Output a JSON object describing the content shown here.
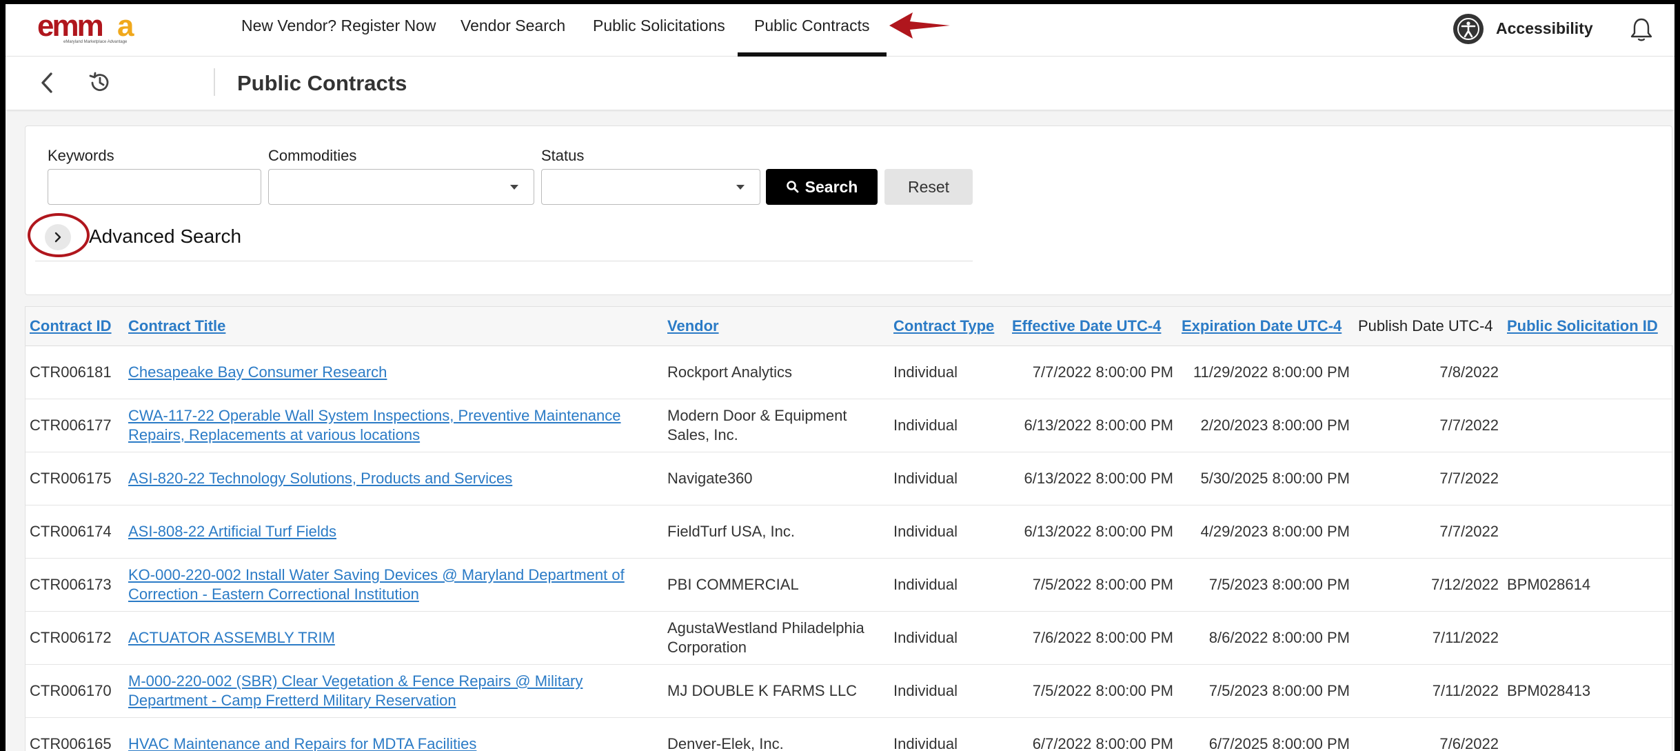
{
  "nav": {
    "logo_text": "emma",
    "logo_tagline": "eMaryland Marketplace Advantage",
    "items": [
      {
        "label": "New Vendor? Register Now"
      },
      {
        "label": "Vendor Search"
      },
      {
        "label": "Public Solicitations"
      },
      {
        "label": "Public Contracts"
      }
    ],
    "accessibility_label": "Accessibility"
  },
  "subheader": {
    "title": "Public Contracts"
  },
  "search": {
    "keywords_label": "Keywords",
    "keywords_value": "",
    "commodities_label": "Commodities",
    "commodities_value": "",
    "status_label": "Status",
    "status_value": "",
    "search_button": "Search",
    "reset_button": "Reset",
    "advanced_label": "Advanced Search"
  },
  "table": {
    "columns": [
      "Contract ID",
      "Contract Title",
      "Vendor",
      "Contract Type",
      "Effective Date UTC-4",
      "Expiration Date UTC-4",
      "Publish Date UTC-4",
      "Public Solicitation ID"
    ],
    "rows": [
      {
        "id": "CTR006181",
        "title": "Chesapeake Bay Consumer Research",
        "vendor": "Rockport Analytics",
        "type": "Individual",
        "effective": "7/7/2022 8:00:00 PM",
        "expiration": "11/29/2022 8:00:00 PM",
        "publish": "7/8/2022",
        "solicitation": ""
      },
      {
        "id": "CTR006177",
        "title": "CWA-117-22 Operable Wall System Inspections, Preventive Maintenance Repairs, Replacements at various locations",
        "vendor": "Modern Door & Equipment Sales, Inc.",
        "type": "Individual",
        "effective": "6/13/2022 8:00:00 PM",
        "expiration": "2/20/2023 8:00:00 PM",
        "publish": "7/7/2022",
        "solicitation": ""
      },
      {
        "id": "CTR006175",
        "title": "ASI-820-22 Technology Solutions, Products and Services",
        "vendor": "Navigate360",
        "type": "Individual",
        "effective": "6/13/2022 8:00:00 PM",
        "expiration": "5/30/2025 8:00:00 PM",
        "publish": "7/7/2022",
        "solicitation": ""
      },
      {
        "id": "CTR006174",
        "title": "ASI-808-22 Artificial Turf Fields",
        "vendor": "FieldTurf USA, Inc.",
        "type": "Individual",
        "effective": "6/13/2022 8:00:00 PM",
        "expiration": "4/29/2023 8:00:00 PM",
        "publish": "7/7/2022",
        "solicitation": ""
      },
      {
        "id": "CTR006173",
        "title": "KO-000-220-002 Install Water Saving Devices @ Maryland Department of Correction - Eastern Correctional Institution",
        "vendor": "PBI COMMERCIAL",
        "type": "Individual",
        "effective": "7/5/2022 8:00:00 PM",
        "expiration": "7/5/2023 8:00:00 PM",
        "publish": "7/12/2022",
        "solicitation": "BPM028614"
      },
      {
        "id": "CTR006172",
        "title": "ACTUATOR ASSEMBLY TRIM",
        "vendor": "AgustaWestland Philadelphia Corporation",
        "type": "Individual",
        "effective": "7/6/2022 8:00:00 PM",
        "expiration": "8/6/2022 8:00:00 PM",
        "publish": "7/11/2022",
        "solicitation": ""
      },
      {
        "id": "CTR006170",
        "title": "M-000-220-002 (SBR) Clear Vegetation & Fence Repairs @ Military Department - Camp Fretterd Military Reservation",
        "vendor": "MJ DOUBLE K FARMS LLC",
        "type": "Individual",
        "effective": "7/5/2022 8:00:00 PM",
        "expiration": "7/5/2023 8:00:00 PM",
        "publish": "7/11/2022",
        "solicitation": "BPM028413"
      },
      {
        "id": "CTR006165",
        "title": "HVAC Maintenance and Repairs for MDTA Facilities",
        "vendor": "Denver-Elek, Inc.",
        "type": "Individual",
        "effective": "6/7/2022 8:00:00 PM",
        "expiration": "6/7/2025 8:00:00 PM",
        "publish": "7/6/2022",
        "solicitation": ""
      }
    ]
  },
  "colors": {
    "link": "#2b7bc6",
    "annotation_red": "#b0161d",
    "logo_red": "#b0161d",
    "logo_gold": "#f0a81c",
    "search_button_bg": "#000000"
  },
  "icons": {
    "back": "chevron-left-icon",
    "history": "history-icon",
    "accessibility": "accessibility-icon",
    "notifications": "bell-icon",
    "search": "search-icon",
    "advanced_toggle": "chevron-right-icon",
    "select_caret": "caret-down-icon"
  }
}
